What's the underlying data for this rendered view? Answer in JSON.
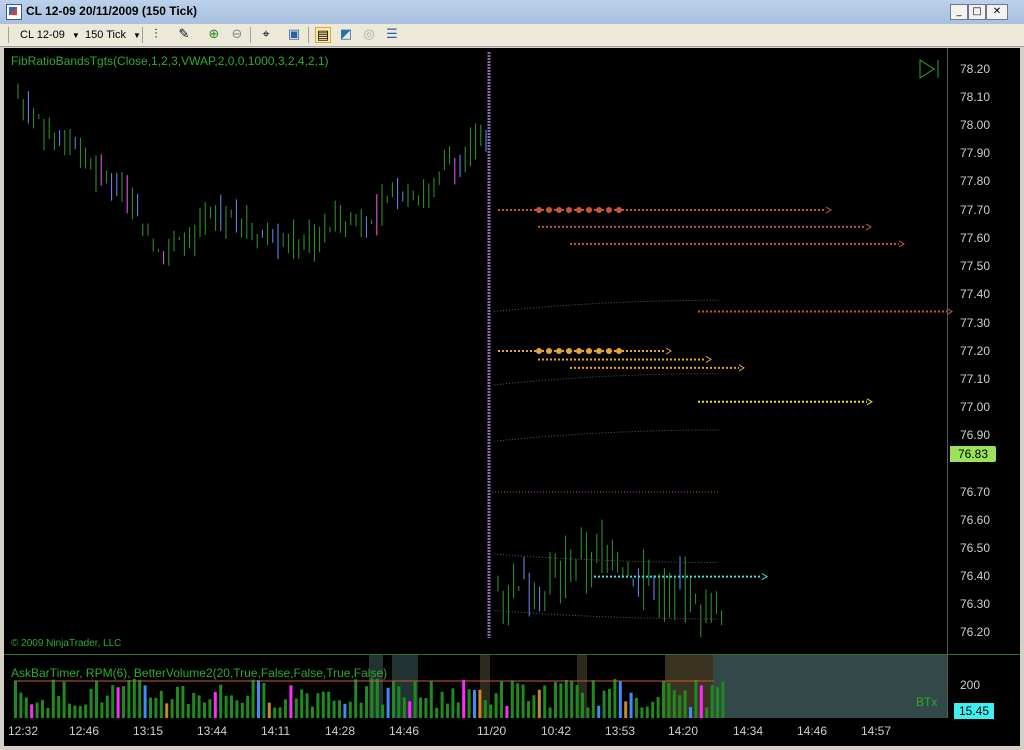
{
  "window": {
    "title": "CL 12-09  20/11/2009 (150 Tick)",
    "buttons": [
      "_",
      "□",
      "✕"
    ]
  },
  "toolbar": {
    "instrument": "CL 12-09",
    "period": "150 Tick"
  },
  "chart": {
    "indicator_label": "FibRatioBandsTgts(Close,1,2,3,VWAP,2,0,0,1000,3,2,4,2,1)",
    "copyright": "© 2009 NinjaTrader, LLC",
    "panel2_label": "AskBarTimer, RPM(6), BetterVolume2(20,True,False,False,True,False)",
    "btx_label": "BTx",
    "last_price": "76.83",
    "volume_badge": "15.45",
    "y_ticks": [
      "78.20",
      "78.10",
      "78.00",
      "77.90",
      "77.80",
      "77.70",
      "77.60",
      "77.50",
      "77.40",
      "77.30",
      "77.20",
      "77.10",
      "77.00",
      "76.90",
      "76.70",
      "76.60",
      "76.50",
      "76.40",
      "76.30",
      "76.20"
    ],
    "volume_tick": "200",
    "x_ticks": [
      "12:32",
      "12:46",
      "13:15",
      "13:44",
      "14:11",
      "14:28",
      "14:46",
      "11/20",
      "10:42",
      "13:53",
      "14:20",
      "14:34",
      "14:46",
      "14:57"
    ]
  }
}
